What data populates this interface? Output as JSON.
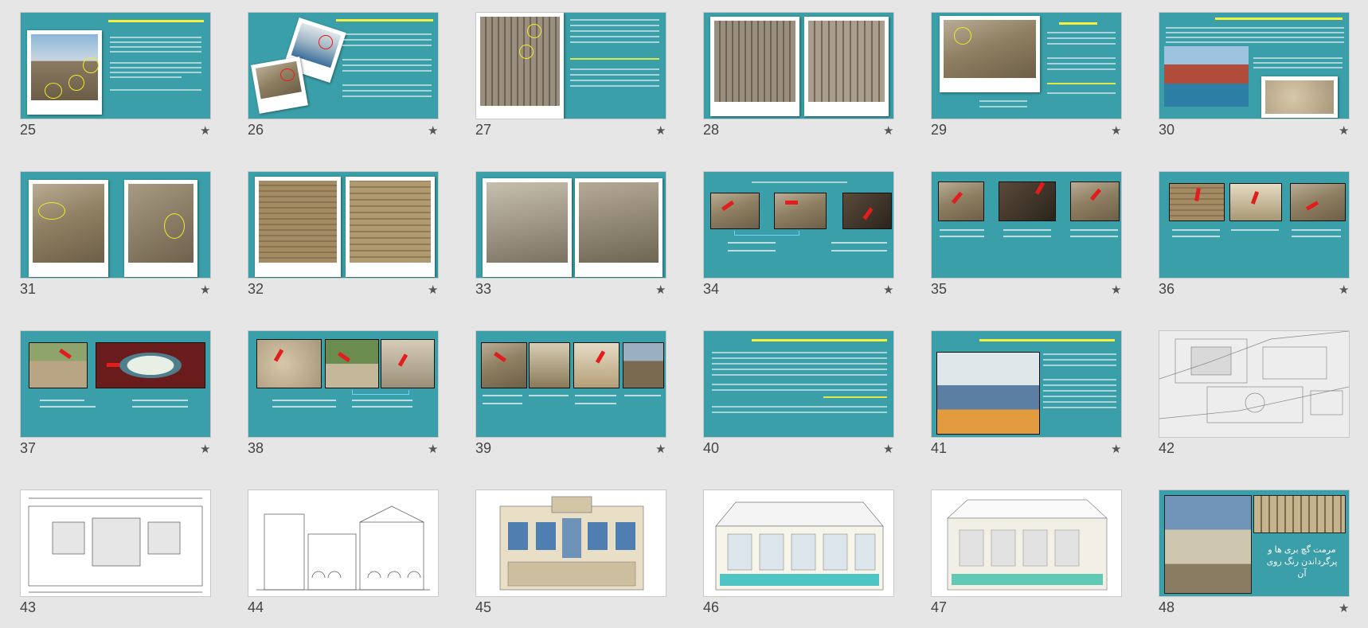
{
  "slides": [
    {
      "number": "25",
      "kind": "teal"
    },
    {
      "number": "26",
      "kind": "teal"
    },
    {
      "number": "27",
      "kind": "teal"
    },
    {
      "number": "28",
      "kind": "teal"
    },
    {
      "number": "29",
      "kind": "teal"
    },
    {
      "number": "30",
      "kind": "teal"
    },
    {
      "number": "31",
      "kind": "teal"
    },
    {
      "number": "32",
      "kind": "teal"
    },
    {
      "number": "33",
      "kind": "teal"
    },
    {
      "number": "34",
      "kind": "teal"
    },
    {
      "number": "35",
      "kind": "teal"
    },
    {
      "number": "36",
      "kind": "teal"
    },
    {
      "number": "37",
      "kind": "teal"
    },
    {
      "number": "38",
      "kind": "teal"
    },
    {
      "number": "39",
      "kind": "teal"
    },
    {
      "number": "40",
      "kind": "teal"
    },
    {
      "number": "41",
      "kind": "teal"
    },
    {
      "number": "42",
      "kind": "white"
    },
    {
      "number": "43",
      "kind": "white"
    },
    {
      "number": "44",
      "kind": "white"
    },
    {
      "number": "45",
      "kind": "white"
    },
    {
      "number": "46",
      "kind": "white"
    },
    {
      "number": "47",
      "kind": "white"
    },
    {
      "number": "48",
      "kind": "teal"
    }
  ],
  "star_glyph": "★",
  "slide48": {
    "text": "مرمت گچ بری ها و پرگرداندن رنگ روی آن"
  },
  "colors": {
    "background": "#e6e6e6",
    "teal": "#3a9fa8",
    "heading_yellow": "#f6f03c",
    "arrow_red": "#e31d1d"
  }
}
